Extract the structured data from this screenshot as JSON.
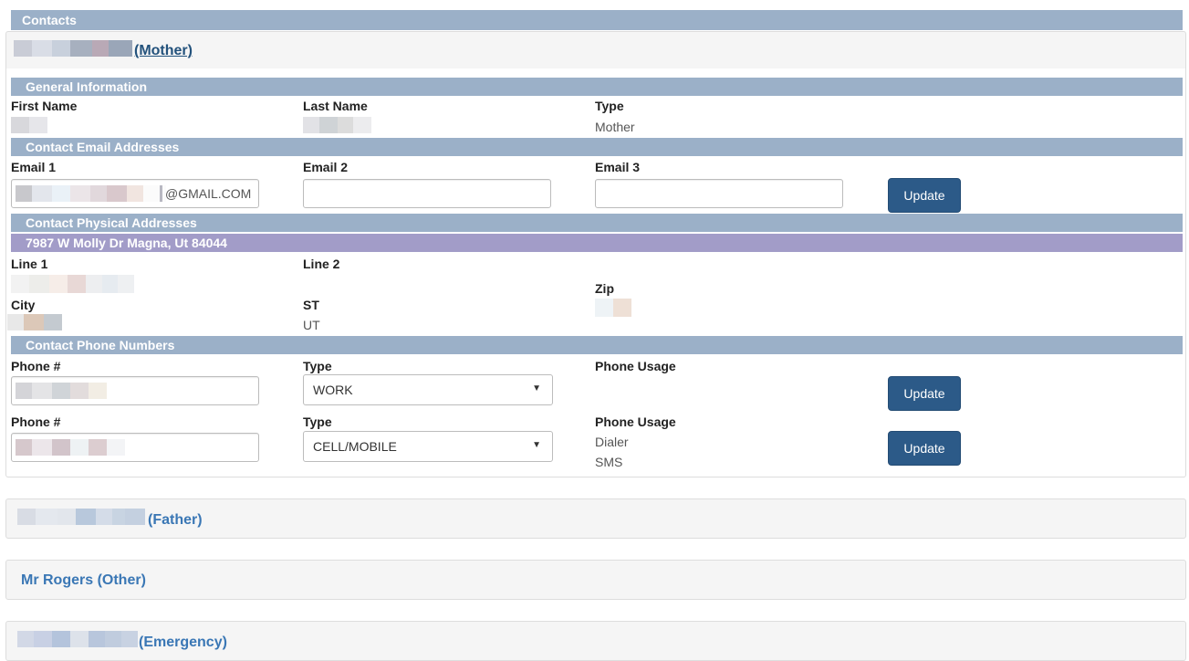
{
  "section_title": "Contacts",
  "contacts": [
    {
      "label": "(Mother)"
    },
    {
      "label": "(Father)"
    },
    {
      "label": "Mr Rogers (Other)"
    },
    {
      "label": "(Emergency)"
    }
  ],
  "general": {
    "header": "General Information",
    "first_name_label": "First Name",
    "last_name_label": "Last Name",
    "type_label": "Type",
    "type_value": "Mother"
  },
  "email": {
    "header": "Contact Email Addresses",
    "email1_label": "Email 1",
    "email1_value_suffix": "@GMAIL.COM",
    "email2_label": "Email 2",
    "email3_label": "Email 3",
    "update_label": "Update"
  },
  "address": {
    "header": "Contact Physical Addresses",
    "summary": "7987 W Molly Dr Magna, Ut 84044",
    "line1_label": "Line 1",
    "line2_label": "Line 2",
    "city_label": "City",
    "st_label": "ST",
    "st_value": "UT",
    "zip_label": "Zip"
  },
  "phones": {
    "header": "Contact Phone Numbers",
    "rows": [
      {
        "phone_label": "Phone #",
        "type_label": "Type",
        "type_value": "WORK",
        "usage_label": "Phone Usage",
        "usage_values": [],
        "update_label": "Update"
      },
      {
        "phone_label": "Phone #",
        "type_label": "Type",
        "type_value": "CELL/MOBILE",
        "usage_label": "Phone Usage",
        "usage_values": [
          "Dialer",
          "SMS"
        ],
        "update_label": "Update"
      }
    ]
  }
}
